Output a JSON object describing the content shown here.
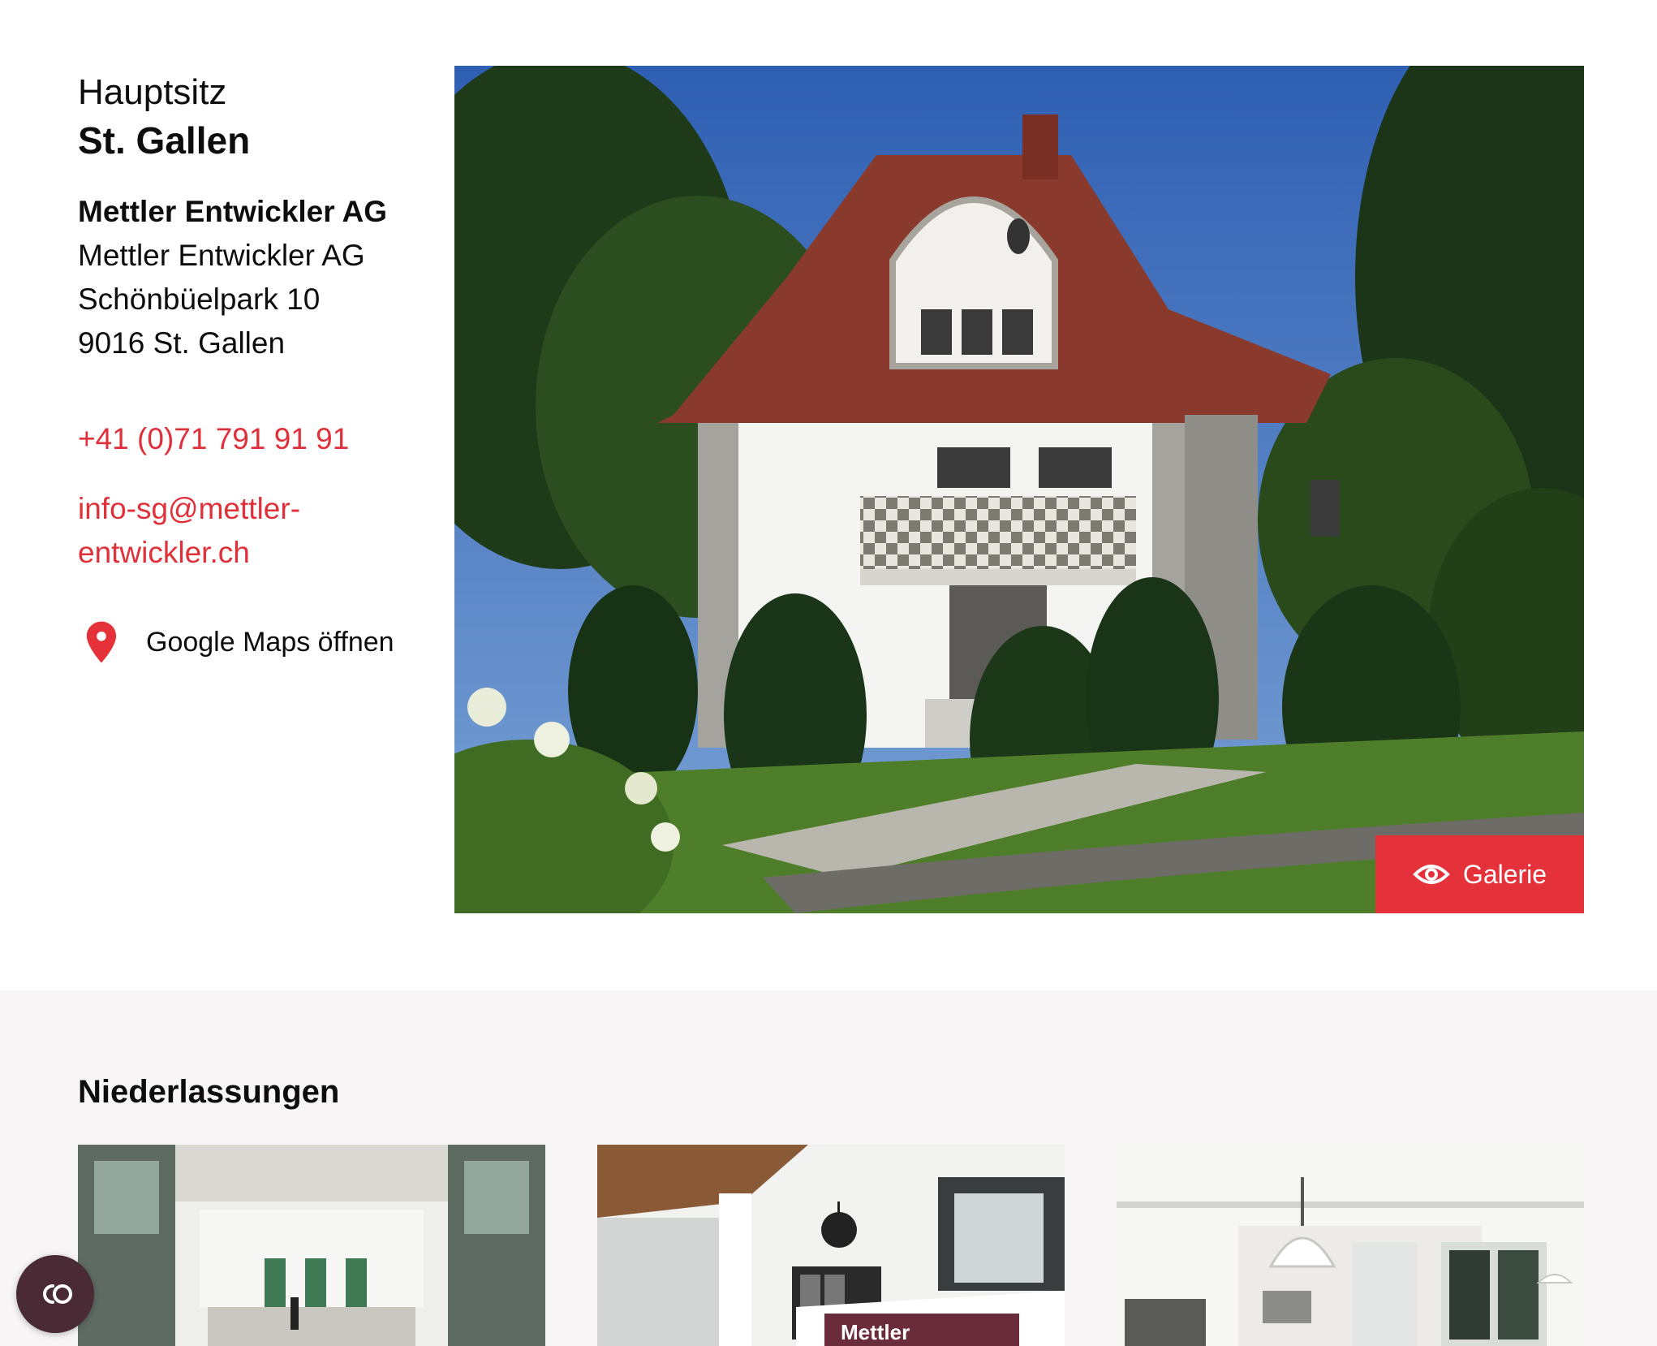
{
  "location": {
    "kicker": "Hauptsitz",
    "city": "St. Gallen",
    "company_name": "Mettler Entwickler AG",
    "address_lines": [
      "Mettler Entwickler AG",
      "Schönbüelpark 10",
      "9016 St. Gallen"
    ],
    "phone": "+41 (0)71 791 91 91",
    "email": "info-sg@mettler-entwickler.ch",
    "maps_label": "Google Maps öffnen",
    "maps_icon": "map-pin-icon"
  },
  "hero": {
    "gallery_label": "Galerie",
    "gallery_icon": "eye-icon"
  },
  "branches": {
    "title": "Niederlassungen",
    "reception_sign_text": "Mettler"
  },
  "widget": {
    "icon": "accessibility-icon"
  },
  "colors": {
    "accent": "#e5323a",
    "link": "#e0303a",
    "branches_bg": "#f7f5f5",
    "widget_bg": "#4a2a35"
  }
}
